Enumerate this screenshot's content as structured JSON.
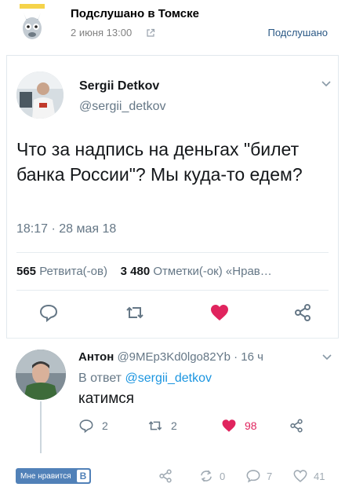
{
  "vk_post": {
    "title": "Подслушано в Томске",
    "date": "2 июня 13:00",
    "source_link": "Подслушано"
  },
  "tweet": {
    "author_name": "Sergii Detkov",
    "author_handle": "@sergii_detkov",
    "text": "Что за надпись на деньгах \"билет банка России\"? Мы куда-то едем?",
    "timestamp": "18:17 · 28 мая 18",
    "retweets_count": "565",
    "retweets_label": "Ретвита(-ов)",
    "likes_count": "3 480",
    "likes_label": "Отметки(-ок)",
    "more_label": "«Нрав…"
  },
  "reply": {
    "author_name": "Антон",
    "author_handle": "@9MEp3Kd0lgo82Yb",
    "age": "· 16 ч",
    "in_reply_prefix": "В ответ",
    "in_reply_handle": "@sergii_detkov",
    "text": "катимся",
    "reply_count": "2",
    "retweet_count": "2",
    "like_count": "98"
  },
  "vk_footer": {
    "like_button_label": "Мне нравится",
    "like_button_icon": "В",
    "reposts": "0",
    "comments": "7",
    "likes": "41"
  },
  "colors": {
    "vk_link": "#2a5885",
    "vk_button": "#5181b8",
    "twitter_blue": "#1b95e0",
    "twitter_gray": "#657786",
    "heart_red": "#e0245e"
  }
}
